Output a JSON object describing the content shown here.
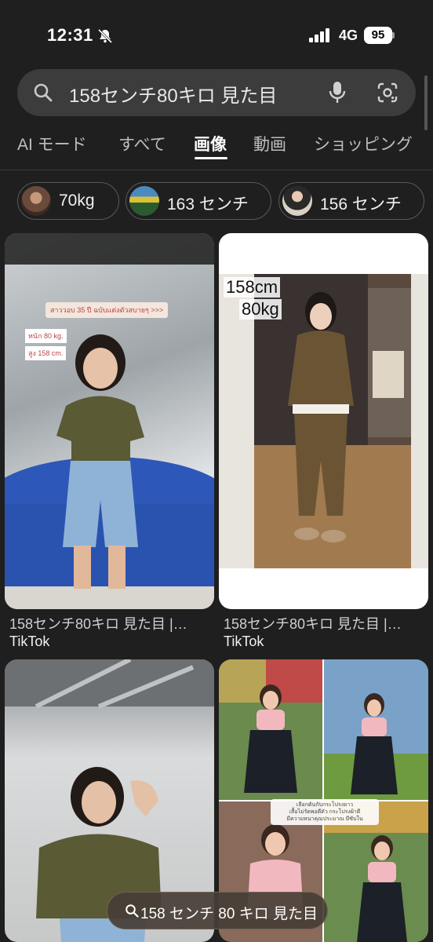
{
  "status_bar": {
    "time": "12:31",
    "network": "4G",
    "battery": "95"
  },
  "search": {
    "query": "158センチ80キロ 見た目"
  },
  "tabs": [
    {
      "label": "AI モード",
      "active": false
    },
    {
      "label": "すべて",
      "active": false
    },
    {
      "label": "画像",
      "active": true
    },
    {
      "label": "動画",
      "active": false
    },
    {
      "label": "ショッピング",
      "active": false
    }
  ],
  "chips": [
    {
      "label": "70kg"
    },
    {
      "label": "163 センチ"
    },
    {
      "label": "156 センチ"
    }
  ],
  "results": [
    {
      "caption": "158センチ80キロ 見た目 |…",
      "source": "TikTok",
      "overlay_lines": [
        "สาววอบ 35 ปี ฉบับแต่งตัวสบายๆ >>>",
        "หนัก 80 kg.",
        "สูง 158 cm."
      ]
    },
    {
      "caption": "158センチ80キロ 見た目 |…",
      "source": "TikTok",
      "overlay_lines": [
        "158cm",
        "80kg"
      ]
    },
    {
      "caption": "",
      "source": "",
      "overlay_lines": []
    },
    {
      "caption": "",
      "source": "",
      "overlay_lines": [
        "เลือกดันกับกระโปรงยาว",
        "เสื้อไม่รัดพอดีตัว กระโปรงผ้าดี",
        "มีความหนาคุณประมาณ มีซับใน"
      ]
    }
  ],
  "bottom_pill": {
    "label": "158 センチ 80 キロ 見た目"
  },
  "colors": {
    "background": "#1f1f1f",
    "search_bg": "#3c3c3c",
    "text": "#e3e3e3"
  }
}
